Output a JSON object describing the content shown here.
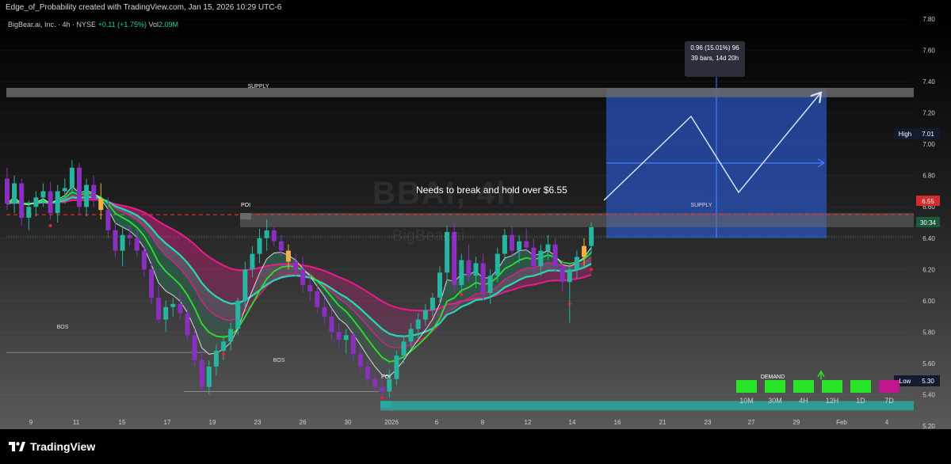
{
  "header": {
    "text": "Edge_of_Probability created with TradingView.com, Jan 15, 2026 10:29 UTC-6"
  },
  "legend": {
    "symbol": "BigBear.ai, Inc. · 4h · NYSE",
    "change": "+0.11 (+1.75%)",
    "vol_label": "Vol",
    "vol_value": "2.09M"
  },
  "watermark": {
    "ticker": "BBAI, 4h",
    "name": "BigBear.ai"
  },
  "annotation": {
    "text": "Needs to break and hold over $6.55"
  },
  "measure": {
    "line1": "0.96 (15.01%) 96",
    "line2": "39 bars, 14d 20h"
  },
  "zones": {
    "supply_top": "SUPPLY",
    "supply_mid": "SUPPLY",
    "demand": "DEMAND",
    "poi_upper": "POI",
    "poi_lower": "POI",
    "bos_left": "BOS",
    "bos_mid": "BOS"
  },
  "price_tags": {
    "high_label": "High",
    "high_value": "7.01",
    "current": "6.55",
    "timer": "30:34",
    "low_label": "Low",
    "low_value": "5.30"
  },
  "timeframes": [
    "10M",
    "30M",
    "4H",
    "12H",
    "1D",
    "7D"
  ],
  "logo": {
    "text": "TradingView"
  },
  "colors": {
    "background": "#000000",
    "supply_zone": "#6a6a6a",
    "demand_zone": "#2aa8a0",
    "measure_box": "#2b56c8",
    "ema_fast": "#29e429",
    "ema_slow": "#27d8b8",
    "ma_magenta": "#e81c8c",
    "candle_up": "#26b5a0",
    "candle_down": "#8a2fc0",
    "dashed_level": "#e03030"
  },
  "chart_data": {
    "type": "candlestick",
    "ylim": [
      5.18,
      7.82
    ],
    "y_ticks": [
      "7.80",
      "7.60",
      "7.40",
      "7.20",
      "7.00",
      "6.80",
      "6.60",
      "6.40",
      "6.20",
      "6.00",
      "5.80",
      "5.60",
      "5.40",
      "5.20"
    ],
    "x_ticks": [
      "9",
      "11",
      "15",
      "17",
      "19",
      "23",
      "26",
      "30",
      "2026",
      "6",
      "8",
      "12",
      "14",
      "16",
      "21",
      "23",
      "27",
      "29",
      "Feb",
      "4"
    ],
    "levels": {
      "high": 7.01,
      "current": 6.55,
      "low": 5.3,
      "supply_top": [
        7.3,
        7.36
      ],
      "supply_mid": [
        6.47,
        6.56
      ],
      "demand": [
        5.3,
        5.36
      ]
    },
    "series": [
      {
        "name": "",
        "values": [
          [
            6.78,
            6.85,
            6.58,
            6.62
          ],
          [
            6.62,
            6.8,
            6.56,
            6.75
          ],
          [
            6.75,
            6.78,
            6.48,
            6.53
          ],
          [
            6.53,
            6.64,
            6.45,
            6.6
          ],
          [
            6.6,
            6.7,
            6.54,
            6.66
          ],
          [
            6.66,
            6.75,
            6.6,
            6.7
          ],
          [
            6.7,
            6.76,
            6.52,
            6.56
          ],
          [
            6.56,
            6.74,
            6.5,
            6.7
          ],
          [
            6.7,
            6.78,
            6.62,
            6.72
          ],
          [
            6.72,
            6.9,
            6.68,
            6.85
          ],
          [
            6.85,
            6.88,
            6.55,
            6.6
          ],
          [
            6.6,
            6.78,
            6.54,
            6.74
          ],
          [
            6.74,
            6.8,
            6.6,
            6.65
          ],
          [
            6.65,
            6.75,
            6.52,
            6.58
          ],
          [
            6.58,
            6.66,
            6.4,
            6.45
          ],
          [
            6.45,
            6.5,
            6.28,
            6.32
          ],
          [
            6.32,
            6.48,
            6.22,
            6.42
          ],
          [
            6.42,
            6.48,
            6.35,
            6.4
          ],
          [
            6.4,
            6.46,
            6.28,
            6.32
          ],
          [
            6.32,
            6.36,
            6.15,
            6.2
          ],
          [
            6.2,
            6.25,
            5.98,
            6.02
          ],
          [
            6.02,
            6.1,
            5.85,
            5.88
          ],
          [
            5.88,
            6.0,
            5.8,
            5.96
          ],
          [
            5.96,
            6.02,
            5.9,
            5.98
          ],
          [
            5.98,
            6.05,
            5.88,
            5.92
          ],
          [
            5.92,
            5.96,
            5.75,
            5.78
          ],
          [
            5.78,
            5.82,
            5.58,
            5.62
          ],
          [
            5.62,
            5.68,
            5.42,
            5.45
          ],
          [
            5.45,
            5.62,
            5.4,
            5.58
          ],
          [
            5.58,
            5.72,
            5.52,
            5.68
          ],
          [
            5.68,
            5.78,
            5.62,
            5.74
          ],
          [
            5.74,
            5.86,
            5.68,
            5.82
          ],
          [
            5.82,
            6.02,
            5.78,
            6.0
          ],
          [
            6.0,
            6.25,
            5.95,
            6.2
          ],
          [
            6.2,
            6.35,
            6.15,
            6.3
          ],
          [
            6.3,
            6.46,
            6.24,
            6.4
          ],
          [
            6.4,
            6.52,
            6.32,
            6.45
          ],
          [
            6.45,
            6.48,
            6.35,
            6.38
          ],
          [
            6.38,
            6.42,
            6.28,
            6.32
          ],
          [
            6.32,
            6.36,
            6.2,
            6.25
          ],
          [
            6.25,
            6.3,
            6.15,
            6.2
          ],
          [
            6.2,
            6.28,
            6.05,
            6.1
          ],
          [
            6.1,
            6.18,
            6.0,
            6.06
          ],
          [
            6.06,
            6.12,
            5.92,
            5.96
          ],
          [
            5.96,
            6.02,
            5.85,
            5.9
          ],
          [
            5.9,
            5.95,
            5.75,
            5.8
          ],
          [
            5.8,
            5.86,
            5.7,
            5.75
          ],
          [
            5.75,
            5.82,
            5.66,
            5.78
          ],
          [
            5.78,
            5.8,
            5.62,
            5.66
          ],
          [
            5.66,
            5.7,
            5.54,
            5.58
          ],
          [
            5.58,
            5.62,
            5.46,
            5.5
          ],
          [
            5.5,
            5.54,
            5.4,
            5.45
          ],
          [
            5.45,
            5.5,
            5.36,
            5.42
          ],
          [
            5.42,
            5.56,
            5.38,
            5.5
          ],
          [
            5.5,
            5.68,
            5.46,
            5.65
          ],
          [
            5.65,
            5.78,
            5.6,
            5.74
          ],
          [
            5.74,
            5.86,
            5.7,
            5.82
          ],
          [
            5.82,
            5.92,
            5.76,
            5.88
          ],
          [
            5.88,
            5.98,
            5.84,
            5.94
          ],
          [
            5.94,
            6.05,
            5.9,
            6.02
          ],
          [
            6.02,
            6.22,
            5.98,
            6.18
          ],
          [
            6.18,
            6.48,
            6.12,
            6.44
          ],
          [
            6.44,
            6.5,
            6.05,
            6.1
          ],
          [
            6.1,
            6.3,
            6.04,
            6.26
          ],
          [
            6.26,
            6.36,
            6.12,
            6.16
          ],
          [
            6.16,
            6.28,
            6.08,
            6.24
          ],
          [
            6.24,
            6.3,
            6.0,
            6.05
          ],
          [
            6.05,
            6.2,
            5.98,
            6.16
          ],
          [
            6.16,
            6.34,
            6.12,
            6.3
          ],
          [
            6.3,
            6.46,
            6.26,
            6.42
          ],
          [
            6.42,
            6.48,
            6.28,
            6.32
          ],
          [
            6.32,
            6.42,
            6.24,
            6.38
          ],
          [
            6.38,
            6.46,
            6.3,
            6.34
          ],
          [
            6.34,
            6.4,
            6.18,
            6.22
          ],
          [
            6.22,
            6.36,
            6.16,
            6.32
          ],
          [
            6.32,
            6.42,
            6.26,
            6.36
          ],
          [
            6.36,
            6.4,
            6.18,
            6.22
          ],
          [
            6.22,
            6.26,
            6.06,
            6.12
          ],
          [
            6.12,
            6.24,
            5.86,
            6.2
          ],
          [
            6.2,
            6.32,
            6.14,
            6.28
          ],
          [
            6.28,
            6.4,
            6.22,
            6.35
          ],
          [
            6.35,
            6.5,
            6.3,
            6.47
          ]
        ]
      }
    ]
  }
}
